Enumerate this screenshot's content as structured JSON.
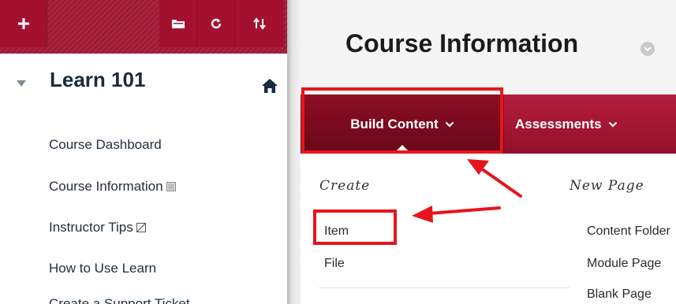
{
  "sidebar": {
    "toolbar": {
      "add_icon": "plus-icon",
      "folder_icon": "folder-icon",
      "refresh_icon": "refresh-icon",
      "reorder_icon": "reorder-arrows-icon",
      "color": "#a3112f"
    },
    "course_title": "Learn 101",
    "nav_items": [
      {
        "label": "Course Dashboard"
      },
      {
        "label": "Course Information",
        "icon": "hidden-content-icon"
      },
      {
        "label": "Instructor Tips",
        "icon": "hidden-from-students-icon"
      },
      {
        "label": "How to Use Learn"
      },
      {
        "label": "Create a Support Ticket"
      }
    ]
  },
  "main": {
    "page_title": "Course Information",
    "action_bar": {
      "build_content_label": "Build Content",
      "assessments_label": "Assessments",
      "color": "#9d1332"
    },
    "dropdown": {
      "create_heading": "Create",
      "new_page_heading": "New Page",
      "create_items": [
        "Item",
        "File"
      ],
      "new_page_items": [
        "Content Folder",
        "Module Page",
        "Blank Page"
      ]
    }
  },
  "annotation": {
    "highlight_color": "#e8141c"
  }
}
